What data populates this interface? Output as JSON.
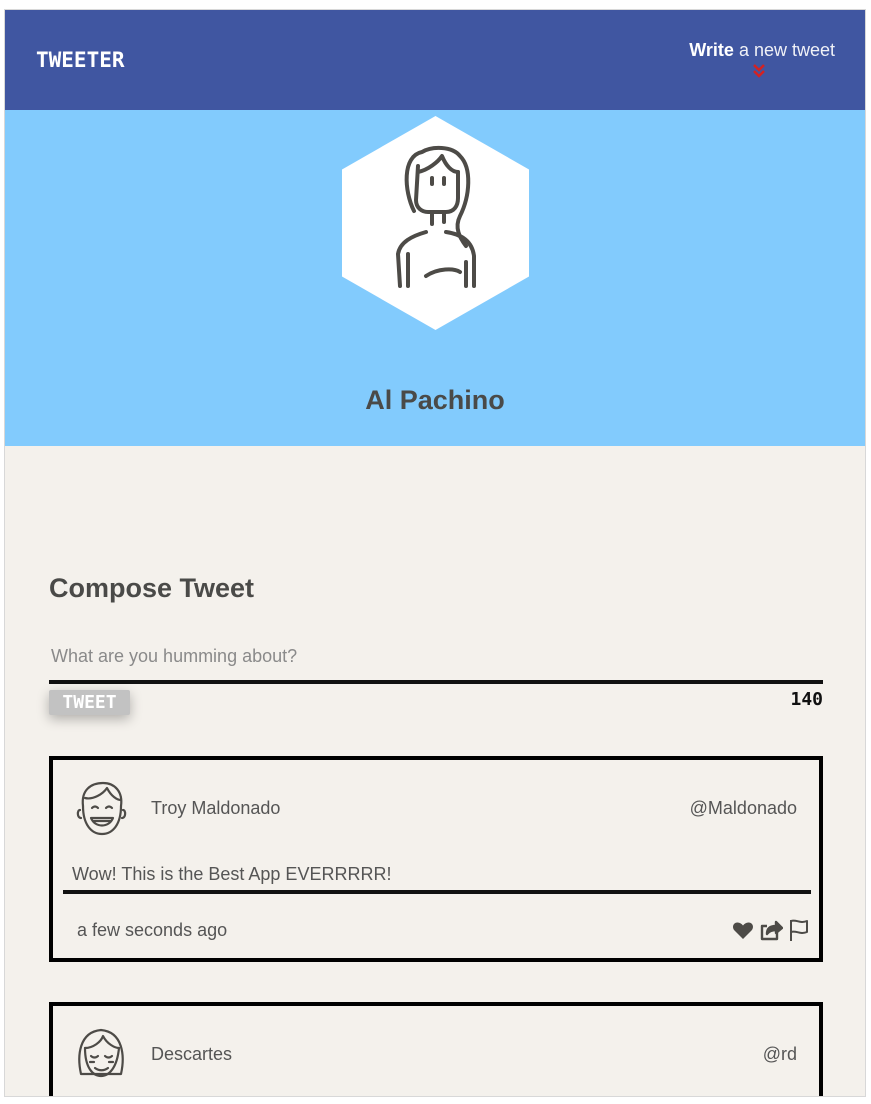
{
  "navbar": {
    "logo": "TWEETER",
    "write_bold": "Write",
    "write_rest": " a new tweet",
    "chevron_icon": "chevron-double-down-icon",
    "colors": {
      "navbar_bg": "#4056a1",
      "chevron": "#d32222"
    }
  },
  "profile": {
    "name": "Al Pachino",
    "avatar_icon": "woman-avatar-icon",
    "colors": {
      "banner_bg": "#82cbfd"
    }
  },
  "compose": {
    "title": "Compose Tweet",
    "placeholder": "What are you humming about?",
    "value": "",
    "button_label": "TWEET",
    "counter": "140"
  },
  "tweets": [
    {
      "name": "Troy Maldonado",
      "handle": "@Maldonado",
      "content": "Wow! This is the Best App EVERRRRR!",
      "time": "a few seconds ago",
      "avatar_icon": "boy-avatar-icon",
      "action_icons": [
        "heart-icon",
        "share-icon",
        "flag-icon"
      ]
    },
    {
      "name": "Descartes",
      "handle": "@rd",
      "avatar_icon": "girl-avatar-icon"
    }
  ]
}
